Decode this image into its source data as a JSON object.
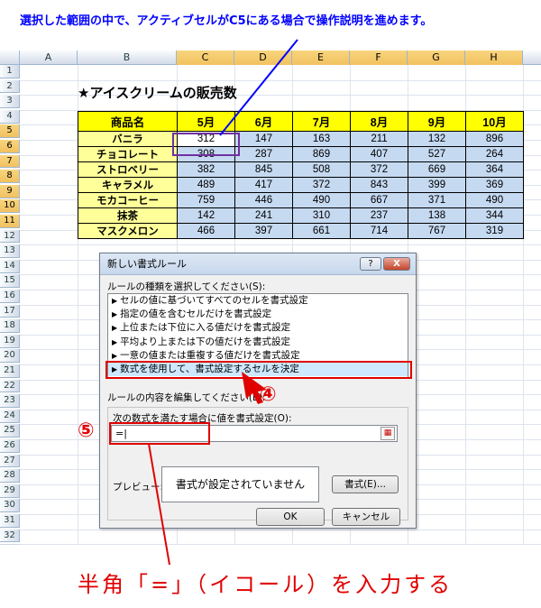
{
  "top_note": "選択した範囲の中で、アクティブセルがC5にある場合で操作説明を進めます。",
  "columns": [
    "A",
    "B",
    "C",
    "D",
    "E",
    "F",
    "G",
    "H"
  ],
  "rows": [
    "1",
    "2",
    "3",
    "4",
    "5",
    "6",
    "7",
    "8",
    "9",
    "10",
    "11",
    "12",
    "13",
    "14",
    "15",
    "16",
    "17",
    "18",
    "19",
    "20",
    "21",
    "22",
    "23",
    "24",
    "25",
    "26",
    "27",
    "28",
    "29",
    "30",
    "31",
    "32"
  ],
  "sheet_title": "★アイスクリームの販売数",
  "table": {
    "headers": [
      "商品名",
      "5月",
      "6月",
      "7月",
      "8月",
      "9月",
      "10月"
    ],
    "rows": [
      [
        "バニラ",
        "312",
        "147",
        "163",
        "211",
        "132",
        "896"
      ],
      [
        "チョコレート",
        "308",
        "287",
        "869",
        "407",
        "527",
        "264"
      ],
      [
        "ストロベリー",
        "382",
        "845",
        "508",
        "372",
        "669",
        "364"
      ],
      [
        "キャラメル",
        "489",
        "417",
        "372",
        "843",
        "399",
        "369"
      ],
      [
        "モカコーヒー",
        "759",
        "446",
        "490",
        "667",
        "371",
        "490"
      ],
      [
        "抹茶",
        "142",
        "241",
        "310",
        "237",
        "138",
        "344"
      ],
      [
        "マスクメロン",
        "466",
        "397",
        "661",
        "714",
        "767",
        "319"
      ]
    ]
  },
  "dialog": {
    "title": "新しい書式ルール",
    "help_btn": "?",
    "close_btn": "X",
    "select_rule_label": "ルールの種類を選択してください(S):",
    "rules": [
      "セルの値に基づいてすべてのセルを書式設定",
      "指定の値を含むセルだけを書式設定",
      "上位または下位に入る値だけを書式設定",
      "平均より上または下の値だけを書式設定",
      "一意の値または重複する値だけを書式設定",
      "数式を使用して、書式設定するセルを決定"
    ],
    "edit_label": "ルールの内容を編集してください(E):",
    "formula_label": "次の数式を満たす場合に値を書式設定(O):",
    "formula_value": "=|",
    "preview_label": "プレビュー:",
    "preview_text": "書式が設定されていません",
    "format_btn": "書式(E)...",
    "ok_btn": "OK",
    "cancel_btn": "キャンセル"
  },
  "marker4": "④",
  "marker5": "⑤",
  "bottom_note": "半角「=」（イコール）を入力する",
  "colors": {
    "accent_red": "#e00000",
    "note_blue": "#0000ff",
    "header_yellow": "#ffff00",
    "name_yellow": "#ffff99",
    "cell_blue": "#c5d9f1",
    "purple": "#7030a0"
  }
}
